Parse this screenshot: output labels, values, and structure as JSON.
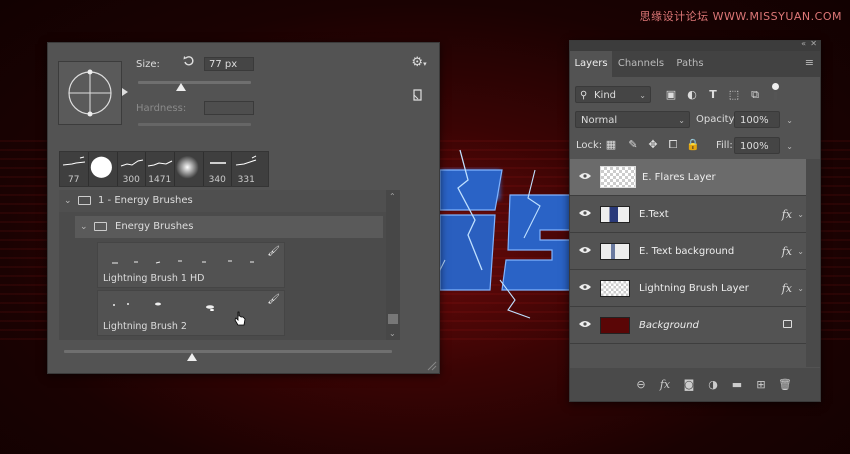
{
  "watermark": "思缘设计论坛 WWW.MISSYUAN.COM",
  "brush_panel": {
    "size_label": "Size:",
    "size_value": "77 px",
    "hardness_label": "Hardness:",
    "size_slider_fraction": 0.38,
    "bottom_slider_fraction": 0.39,
    "presets": [
      {
        "size": "77"
      },
      {
        "size": ""
      },
      {
        "size": "300"
      },
      {
        "size": "1471"
      },
      {
        "size": ""
      },
      {
        "size": "340"
      },
      {
        "size": "331"
      }
    ],
    "folders": [
      {
        "label": "1 - Energy Brushes"
      },
      {
        "label": "Energy Brushes"
      }
    ],
    "brushes": [
      {
        "label": "Lightning Brush 1 HD"
      },
      {
        "label": "Lightning Brush 2"
      }
    ],
    "icons": {
      "reset": "reset-icon",
      "gear": "gear-icon",
      "new": "new-preset-icon"
    }
  },
  "layers_panel": {
    "tabs": [
      "Layers",
      "Channels",
      "Paths"
    ],
    "active_tab": "Layers",
    "filter_kind": "Kind",
    "blend_mode": "Normal",
    "opacity_label": "Opacity:",
    "opacity_value": "100%",
    "lock_label": "Lock:",
    "fill_label": "Fill:",
    "fill_value": "100%",
    "layers": [
      {
        "name": "E. Flares Layer",
        "selected": true,
        "fx": false,
        "locked": false,
        "italic": false
      },
      {
        "name": "E.Text",
        "selected": false,
        "fx": true,
        "locked": false,
        "italic": false
      },
      {
        "name": "E. Text background",
        "selected": false,
        "fx": true,
        "locked": false,
        "italic": false
      },
      {
        "name": "Lightning Brush Layer",
        "selected": false,
        "fx": true,
        "locked": false,
        "italic": false
      },
      {
        "name": "Background",
        "selected": false,
        "fx": false,
        "locked": true,
        "italic": true
      }
    ],
    "fx_symbol": "fx",
    "accent_color": "#6b6b6b"
  }
}
